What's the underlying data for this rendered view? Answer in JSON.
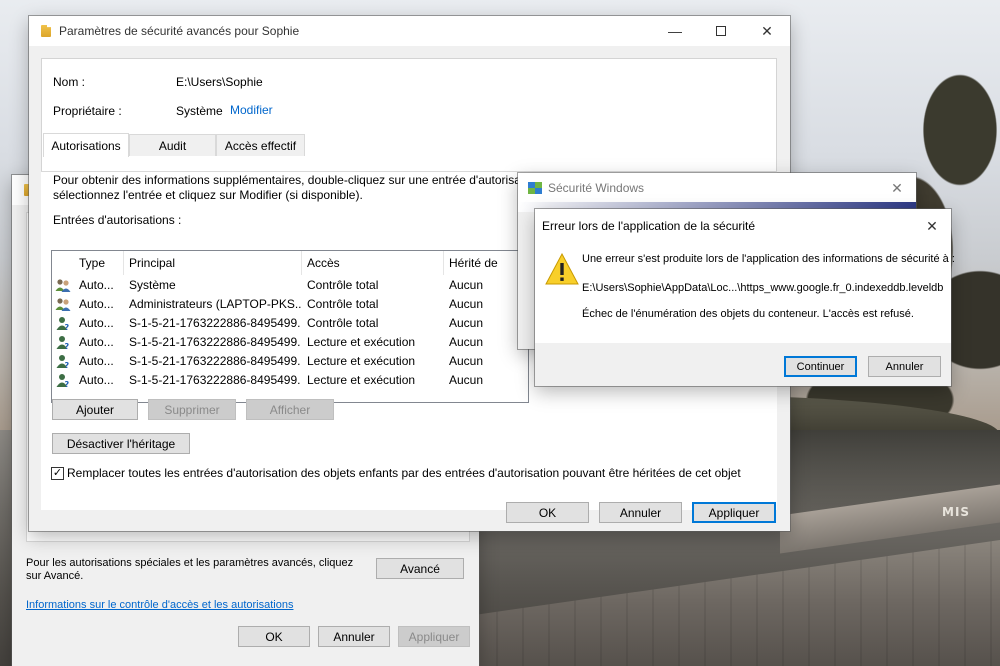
{
  "colors": {
    "accent": "#0078d7",
    "link": "#0066cc",
    "window_bg": "#f0f0f0"
  },
  "props_window": {
    "footer_text": "Pour les autorisations spéciales et les paramètres avancés, cliquez sur Avancé.",
    "advanced_button": "Avancé",
    "link": "Informations sur le contrôle d'accès et les autorisations",
    "ok_button": "OK",
    "cancel_button": "Annuler",
    "apply_button": "Appliquer"
  },
  "main_window": {
    "title": "Paramètres de sécurité avancés pour Sophie",
    "name_label": "Nom :",
    "name_value": "E:\\Users\\Sophie",
    "owner_label": "Propriétaire :",
    "owner_value": "Système",
    "owner_modify_link": "Modifier",
    "tabs": [
      {
        "label": "Autorisations",
        "active": true
      },
      {
        "label": "Audit",
        "active": false
      },
      {
        "label": "Accès effectif",
        "active": false
      }
    ],
    "info_line1": "Pour obtenir des informations supplémentaires, double-cliquez sur une entrée d'autorisa",
    "info_line2": "sélectionnez l'entrée et cliquez sur Modifier (si disponible).",
    "entries_label": "Entrées d'autorisations :",
    "table": {
      "headers": [
        "Type",
        "Principal",
        "Accès",
        "Hérité de"
      ],
      "rows": [
        {
          "type": "Auto...",
          "principal": "Système",
          "access": "Contrôle total",
          "inherited": "Aucun",
          "icon": "group-icon"
        },
        {
          "type": "Auto...",
          "principal": "Administrateurs (LAPTOP-PKS...",
          "access": "Contrôle total",
          "inherited": "Aucun",
          "icon": "group-icon"
        },
        {
          "type": "Auto...",
          "principal": "S-1-5-21-1763222886-8495499...",
          "access": "Contrôle total",
          "inherited": "Aucun",
          "icon": "unknown-user-icon"
        },
        {
          "type": "Auto...",
          "principal": "S-1-5-21-1763222886-8495499...",
          "access": "Lecture et exécution",
          "inherited": "Aucun",
          "icon": "unknown-user-icon"
        },
        {
          "type": "Auto...",
          "principal": "S-1-5-21-1763222886-8495499...",
          "access": "Lecture et exécution",
          "inherited": "Aucun",
          "icon": "unknown-user-icon"
        },
        {
          "type": "Auto...",
          "principal": "S-1-5-21-1763222886-8495499...",
          "access": "Lecture et exécution",
          "inherited": "Aucun",
          "icon": "unknown-user-icon"
        }
      ]
    },
    "add_button": "Ajouter",
    "remove_button": "Supprimer",
    "view_button": "Afficher",
    "disable_inheritance_button": "Désactiver l'héritage",
    "replace_checkbox_label": "Remplacer toutes les entrées d'autorisation des objets enfants par des entrées d'autorisation pouvant être héritées de cet objet",
    "replace_checkbox_checked": true,
    "ok_button": "OK",
    "cancel_button": "Annuler",
    "apply_button": "Appliquer"
  },
  "windows_security": {
    "title": "Sécurité Windows"
  },
  "error_dialog": {
    "title": "Erreur lors de l'application de la sécurité",
    "message1": "Une erreur s'est produite lors de l'application des informations de sécurité à :",
    "path": "E:\\Users\\Sophie\\AppData\\Loc...\\https_www.google.fr_0.indexeddb.leveldb",
    "message2": "Échec de l'énumération des objets du conteneur. L'accès est refusé.",
    "continue_button": "Continuer",
    "cancel_button": "Annuler"
  },
  "wallpaper": {
    "graffiti": "MIS"
  }
}
